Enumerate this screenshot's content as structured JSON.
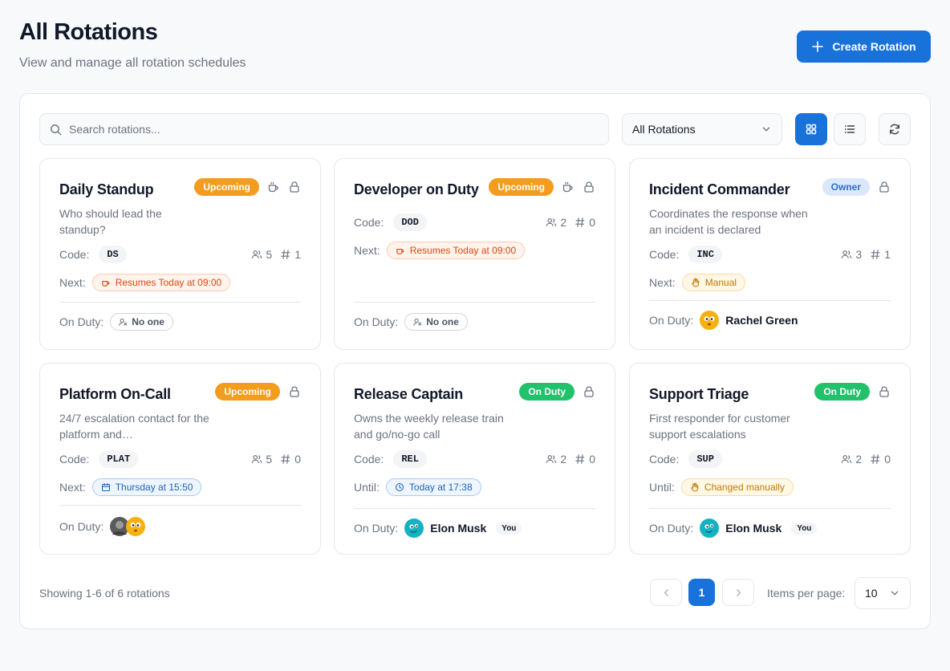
{
  "header": {
    "title": "All Rotations",
    "subtitle": "View and manage all rotation schedules",
    "create_label": "Create Rotation"
  },
  "toolbar": {
    "search_placeholder": "Search rotations...",
    "filter_value": "All Rotations",
    "view_mode": "grid"
  },
  "labels": {
    "code": "Code:",
    "next": "Next:",
    "until": "Until:",
    "on_duty": "On Duty:",
    "no_one": "No one",
    "you": "You"
  },
  "colors": {
    "primary": "#1872d9",
    "upcoming": "#f39c1d",
    "on_duty": "#22c16b",
    "owner_bg": "#dbe8fb"
  },
  "cards": [
    {
      "title": "Daily Standup",
      "description": "Who should lead the standup?",
      "badge": "Upcoming",
      "badge_type": "upcoming",
      "paused_icon": true,
      "code": "DS",
      "members": "5",
      "count": "1",
      "next_label": "Next:",
      "next": "Resumes Today at 09:00",
      "next_style": "orange",
      "next_icon": "coffee-icon",
      "on_duty": "No one"
    },
    {
      "title": "Developer on Duty",
      "description": "",
      "badge": "Upcoming",
      "badge_type": "upcoming",
      "paused_icon": true,
      "code": "DOD",
      "members": "2",
      "count": "0",
      "next_label": "Next:",
      "next": "Resumes Today at 09:00",
      "next_style": "orange",
      "next_icon": "coffee-icon",
      "on_duty": "No one"
    },
    {
      "title": "Incident Commander",
      "description": "Coordinates the response when an incident is declared",
      "badge": "Owner",
      "badge_type": "owner",
      "paused_icon": false,
      "code": "INC",
      "members": "3",
      "count": "1",
      "next_label": "Next:",
      "next": "Manual",
      "next_style": "amber",
      "next_icon": "hand-icon",
      "on_duty": "Rachel Green"
    },
    {
      "title": "Platform On-Call",
      "description": "24/7 escalation contact for the platform and…",
      "badge": "Upcoming",
      "badge_type": "upcoming",
      "paused_icon": false,
      "code": "PLAT",
      "members": "5",
      "count": "0",
      "next_label": "Next:",
      "next": "Thursday at 15:50",
      "next_style": "blue",
      "next_icon": "calendar-icon",
      "on_duty": ""
    },
    {
      "title": "Release Captain",
      "description": "Owns the weekly release train and go/no-go call",
      "badge": "On Duty",
      "badge_type": "onduty",
      "paused_icon": false,
      "code": "REL",
      "members": "2",
      "count": "0",
      "next_label": "Until:",
      "next": "Today at 17:38",
      "next_style": "blue",
      "next_icon": "clock-icon",
      "on_duty": "Elon Musk"
    },
    {
      "title": "Support Triage",
      "description": "First responder for customer support escalations",
      "badge": "On Duty",
      "badge_type": "onduty",
      "paused_icon": false,
      "code": "SUP",
      "members": "2",
      "count": "0",
      "next_label": "Until:",
      "next": "Changed manually",
      "next_style": "amber",
      "next_icon": "hand-icon",
      "on_duty": "Elon Musk"
    }
  ],
  "footer": {
    "showing": "Showing 1-6 of 6 rotations",
    "current_page": "1",
    "items_per_page_label": "Items per page:",
    "items_per_page": "10"
  }
}
